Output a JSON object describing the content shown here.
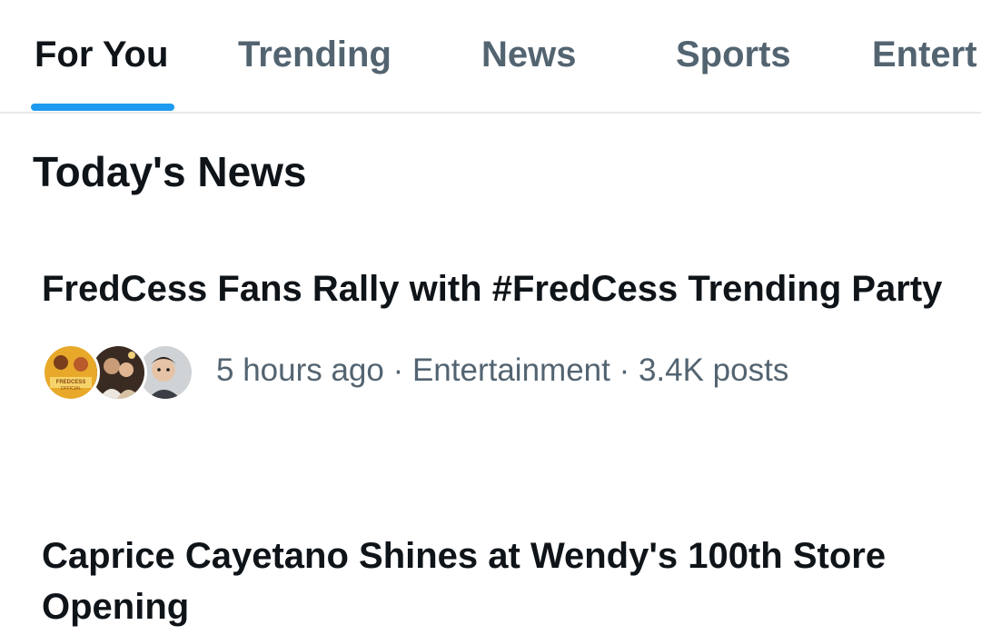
{
  "tabs": [
    {
      "label": "For You",
      "active": true
    },
    {
      "label": "Trending",
      "active": false
    },
    {
      "label": "News",
      "active": false
    },
    {
      "label": "Sports",
      "active": false
    },
    {
      "label": "Entert",
      "active": false
    }
  ],
  "accent_color": "#1d9bf0",
  "section": {
    "title": "Today's News"
  },
  "stories": [
    {
      "title": "FredCess Fans Rally with #FredCess Trending Party",
      "meta": "5 hours ago · Entertainment · 3.4K posts",
      "avatars": [
        {
          "name": "fredcess-official-avatar",
          "badge_text": "FREDCESS OFFICIAL"
        },
        {
          "name": "couple-photo-avatar"
        },
        {
          "name": "child-photo-avatar"
        }
      ]
    },
    {
      "title": "Caprice Cayetano Shines at Wendy's 100th Store Opening"
    }
  ]
}
